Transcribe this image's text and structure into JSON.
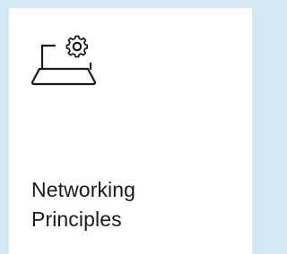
{
  "card": {
    "title_line_1": "Networking",
    "title_line_2": "Principles",
    "icon": "laptop-gear-icon"
  },
  "colors": {
    "background": "#d3e9f6",
    "card": "#ffffff",
    "text": "#1a1a1a",
    "icon_stroke": "#1a1a1a"
  }
}
